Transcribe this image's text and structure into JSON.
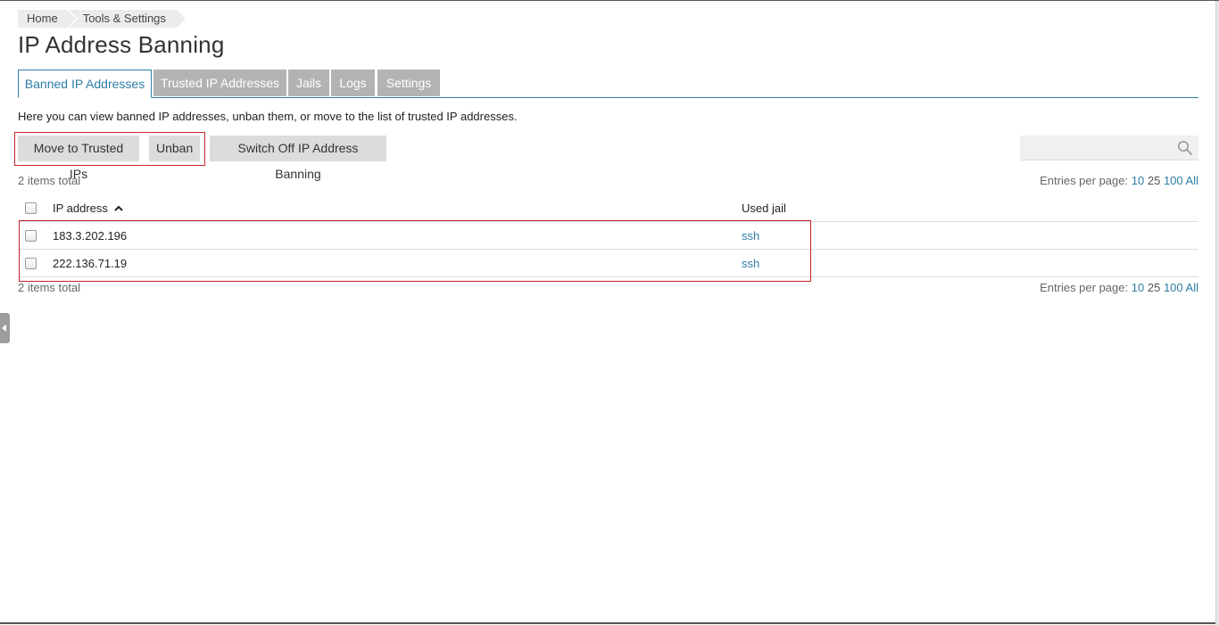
{
  "breadcrumb": {
    "items": [
      "Home",
      "Tools & Settings"
    ]
  },
  "page": {
    "title": "IP Address Banning",
    "description": "Here you can view banned IP addresses, unban them, or move to the list of trusted IP addresses."
  },
  "tabs": [
    {
      "label": "Banned IP Addresses",
      "active": true
    },
    {
      "label": "Trusted IP Addresses",
      "active": false
    },
    {
      "label": "Jails",
      "active": false
    },
    {
      "label": "Logs",
      "active": false
    },
    {
      "label": "Settings",
      "active": false
    }
  ],
  "toolbar": {
    "move_label": "Move to Trusted IPs",
    "unban_label": "Unban",
    "switch_off_label": "Switch Off IP Address Banning"
  },
  "search": {
    "icon": "search-icon",
    "placeholder": ""
  },
  "list": {
    "total_label": "2 items total",
    "per_page_label": "Entries per page:",
    "per_page_options": [
      "10",
      "25",
      "100",
      "All"
    ],
    "current_per_page": "25",
    "columns": {
      "ip": "IP address",
      "jail": "Used jail"
    },
    "rows": [
      {
        "ip": "183.3.202.196",
        "jail": "ssh"
      },
      {
        "ip": "222.136.71.19",
        "jail": "ssh"
      }
    ]
  },
  "colors": {
    "accent": "#2e7ea6",
    "highlight": "#c8232c",
    "tab_inactive": "#b3b3b3"
  }
}
